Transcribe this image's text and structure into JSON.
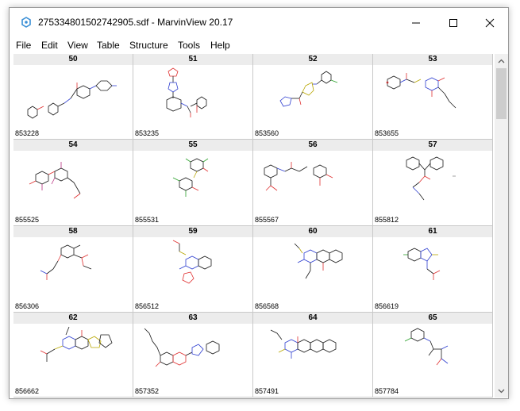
{
  "window": {
    "title": "275334801502742905.sdf - MarvinView 20.17"
  },
  "menu": [
    {
      "label": "File"
    },
    {
      "label": "Edit"
    },
    {
      "label": "View"
    },
    {
      "label": "Table"
    },
    {
      "label": "Structure"
    },
    {
      "label": "Tools"
    },
    {
      "label": "Help"
    }
  ],
  "cells": [
    {
      "index": "50",
      "id": "853228"
    },
    {
      "index": "51",
      "id": "853235"
    },
    {
      "index": "52",
      "id": "853560"
    },
    {
      "index": "53",
      "id": "853655"
    },
    {
      "index": "54",
      "id": "855525"
    },
    {
      "index": "55",
      "id": "855531"
    },
    {
      "index": "56",
      "id": "855567"
    },
    {
      "index": "57",
      "id": "855812"
    },
    {
      "index": "58",
      "id": "856306"
    },
    {
      "index": "59",
      "id": "856512"
    },
    {
      "index": "60",
      "id": "856568"
    },
    {
      "index": "61",
      "id": "856619"
    },
    {
      "index": "62",
      "id": "856662"
    },
    {
      "index": "63",
      "id": "857352"
    },
    {
      "index": "64",
      "id": "857491"
    },
    {
      "index": "65",
      "id": "857784"
    }
  ],
  "colors": {
    "bond": "#1a1a1a",
    "oxygen": "#e03030",
    "nitrogen": "#2f3fd0",
    "sulfur": "#b8a600",
    "halogen": "#2aa02a"
  },
  "icons": [
    "app-icon",
    "minimize-icon",
    "maximize-icon",
    "close-icon",
    "scroll-up-icon",
    "scroll-down-icon"
  ]
}
